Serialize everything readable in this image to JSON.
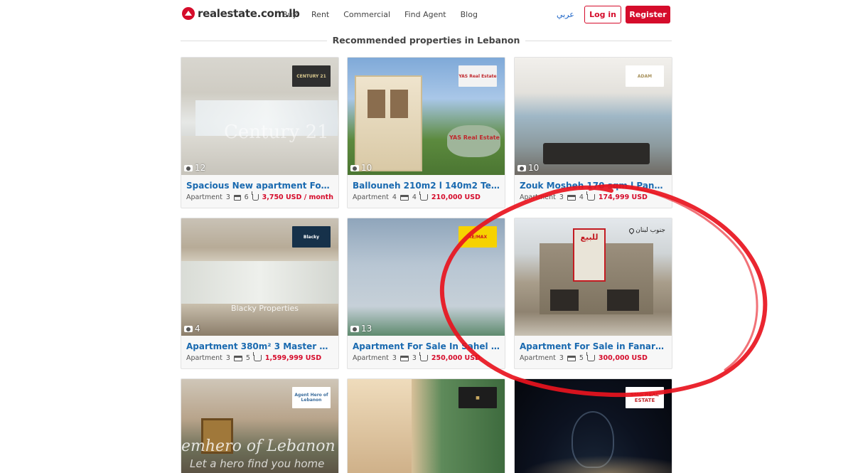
{
  "header": {
    "logo_text": "realestate.com.lb",
    "nav": [
      "Buy",
      "Rent",
      "Commercial",
      "Find Agent",
      "Blog"
    ],
    "language": "عربي",
    "login_label": "Log in",
    "register_label": "Register"
  },
  "section": {
    "title": "Recommended properties in Lebanon"
  },
  "cards": [
    {
      "title": "Spacious New apartment For Rent ...",
      "type": "Apartment",
      "beds": "3",
      "baths": "6",
      "price": "3,750 USD / month",
      "photos": "12",
      "agency": "CENTURY 21",
      "watermark": "Century 21"
    },
    {
      "title": "Ballouneh 210m2 l 140m2 Terrace l ...",
      "type": "Apartment",
      "beds": "4",
      "baths": "4",
      "price": "210,000 USD",
      "photos": "10",
      "agency": "YAS Real Estate",
      "watermark": "YAS Real Estate"
    },
    {
      "title": "Zouk Mosbeh 170 sqm l Panoramic ...",
      "type": "Apartment",
      "beds": "3",
      "baths": "4",
      "price": "174,999 USD",
      "photos": "10",
      "agency": "ADAM",
      "watermark": ""
    },
    {
      "title": "Apartment 380m² 3 Master Beds Fo...",
      "type": "Apartment",
      "beds": "3",
      "baths": "5",
      "price": "1,599,999 USD",
      "photos": "4",
      "agency": "Blacky",
      "watermark": "Blacky Properties"
    },
    {
      "title": "Apartment For Sale In Sahel Alma ...",
      "type": "Apartment",
      "beds": "3",
      "baths": "3",
      "price": "250,000 USD",
      "photos": "13",
      "agency": "RE/MAX",
      "watermark": ""
    },
    {
      "title": "Apartment For Sale in Fanar With ...",
      "type": "Apartment",
      "beds": "3",
      "baths": "5",
      "price": "300,000 USD",
      "photos": "",
      "agency": "",
      "watermark": "",
      "location": "جنوب لبنان",
      "sign_text": "للبيع"
    },
    {
      "title": "",
      "photos": "",
      "agency": "Agent Hero of Lebanon",
      "watermark": "emhero of Lebanon",
      "watermark2": "Let a hero find you home"
    },
    {
      "title": "",
      "photos": "",
      "agency": "",
      "watermark": ""
    },
    {
      "title": "",
      "photos": "",
      "agency": "SMG REAL ESTATE",
      "watermark": ""
    }
  ],
  "colors": {
    "brand_red": "#d50c2b",
    "title_blue": "#1a6ab0",
    "annotation_red": "#e8141e"
  }
}
